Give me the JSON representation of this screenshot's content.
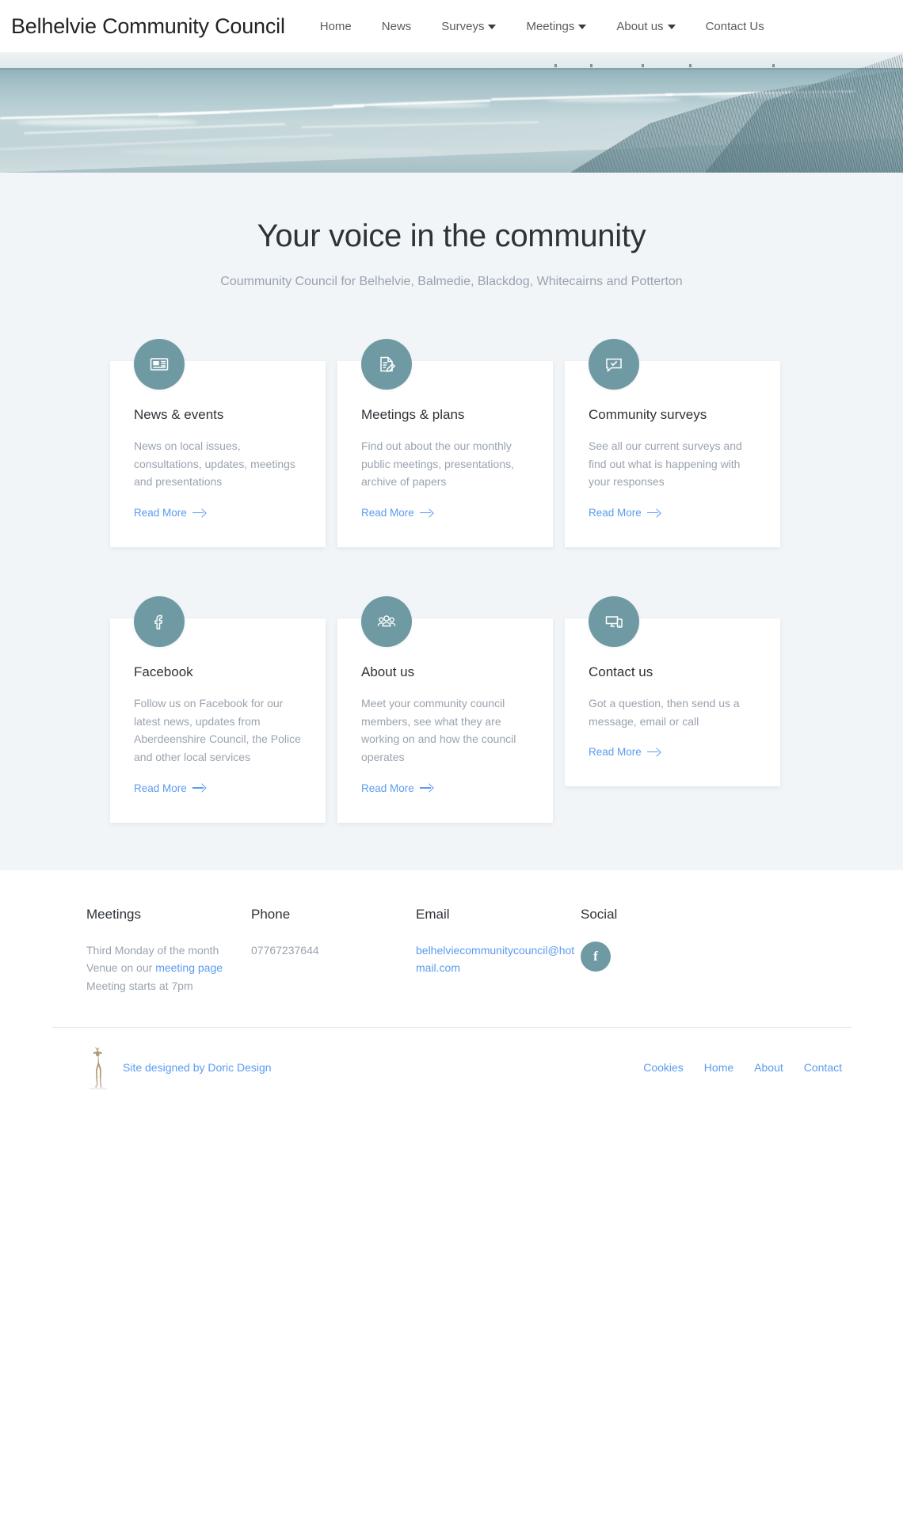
{
  "site": {
    "brand": "Belhelvie Community Council",
    "accent_teal": "#6f9aa3",
    "accent_blue": "#5b9bf0",
    "section_bg": "#f1f5f8"
  },
  "nav": {
    "items": [
      {
        "label": "Home",
        "has_dropdown": false
      },
      {
        "label": "News",
        "has_dropdown": false
      },
      {
        "label": "Surveys",
        "has_dropdown": true
      },
      {
        "label": "Meetings",
        "has_dropdown": true
      },
      {
        "label": "About us",
        "has_dropdown": true
      },
      {
        "label": "Contact Us",
        "has_dropdown": false
      }
    ]
  },
  "hero": {
    "alt": "beach-dunes-photo"
  },
  "main": {
    "title": "Your voice in the community",
    "subtitle": "Coummunity Council for Belhelvie, Balmedie, Blackdog, Whitecairns and Potterton",
    "cards": [
      {
        "icon": "newspaper-icon",
        "title": "News & events",
        "text": "News on local issues, consultations, updates, meetings and presentations",
        "link": "Read More"
      },
      {
        "icon": "document-edit-icon",
        "title": "Meetings & plans",
        "text": "Find out about the our monthly public meetings, presentations, archive of papers",
        "link": "Read More"
      },
      {
        "icon": "speech-bubble-check-icon",
        "title": "Community surveys",
        "text": "See all our current surveys and find out what is happening with your responses",
        "link": "Read More"
      },
      {
        "icon": "facebook-icon",
        "title": "Facebook",
        "text": "Follow us on Facebook for our latest news, updates from Aberdeenshire Council, the Police and other local services",
        "link": "Read More"
      },
      {
        "icon": "people-group-icon",
        "title": "About us",
        "text": "Meet your community council members, see what they are working on and how the council operates",
        "link": "Read More"
      },
      {
        "icon": "devices-icon",
        "title": "Contact us",
        "text": "Got a question, then send us a message, email or call",
        "link": "Read More"
      }
    ]
  },
  "footer": {
    "meetings": {
      "heading": "Meetings",
      "line1": "Third Monday of the month",
      "line2_prefix": "Venue on our ",
      "line2_link": "meeting page",
      "line3": "Meeting starts at 7pm"
    },
    "phone": {
      "heading": "Phone",
      "number": "07767237644"
    },
    "email": {
      "heading": "Email",
      "address": "belhelviecommunitycouncil@hotmail.com"
    },
    "social": {
      "heading": "Social",
      "facebook_glyph": "f"
    },
    "designer": {
      "text": "Site designed by Doric Design",
      "logo": "deer-logo"
    },
    "bottom_links": [
      {
        "label": "Cookies"
      },
      {
        "label": "Home"
      },
      {
        "label": "About"
      },
      {
        "label": "Contact"
      }
    ]
  }
}
